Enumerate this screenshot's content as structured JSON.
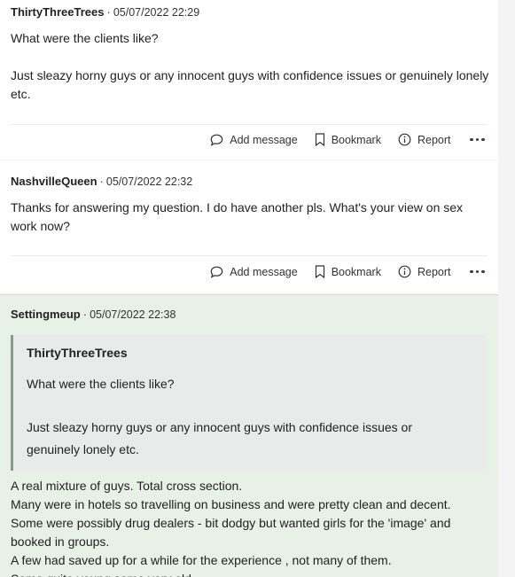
{
  "actions": {
    "add_message": "Add message",
    "bookmark": "Bookmark",
    "report": "Report"
  },
  "posts": [
    {
      "author": "ThirtyThreeTrees",
      "date": "05/07/2022 22:29",
      "lines": [
        "What were the clients like?",
        "",
        "Just sleazy horny guys or any innocent guys with confidence issues or genuinely lonely etc."
      ]
    },
    {
      "author": "NashvilleQueen",
      "date": "05/07/2022 22:32",
      "lines": [
        "Thanks for answering my question. I do have another pls. What's your view on sex work now?"
      ]
    },
    {
      "author": "Settingmeup",
      "date": "05/07/2022 22:38",
      "quote": {
        "author": "ThirtyThreeTrees",
        "line1": "What were the clients like?",
        "line2": "Just sleazy horny guys or any innocent guys with confidence issues or",
        "line3": "genuinely lonely etc."
      },
      "lines": [
        "A real mixture of guys. Total cross section.",
        "Many were in hotels so travelling on business and were pretty clean and decent.",
        "Some were possibly drug dealers - bit dodgy but wanted girls for the 'image' and",
        "booked in groups.",
        "A few had saved up for a while for the experience , not many of them.",
        "Some quite young some very old."
      ]
    }
  ]
}
